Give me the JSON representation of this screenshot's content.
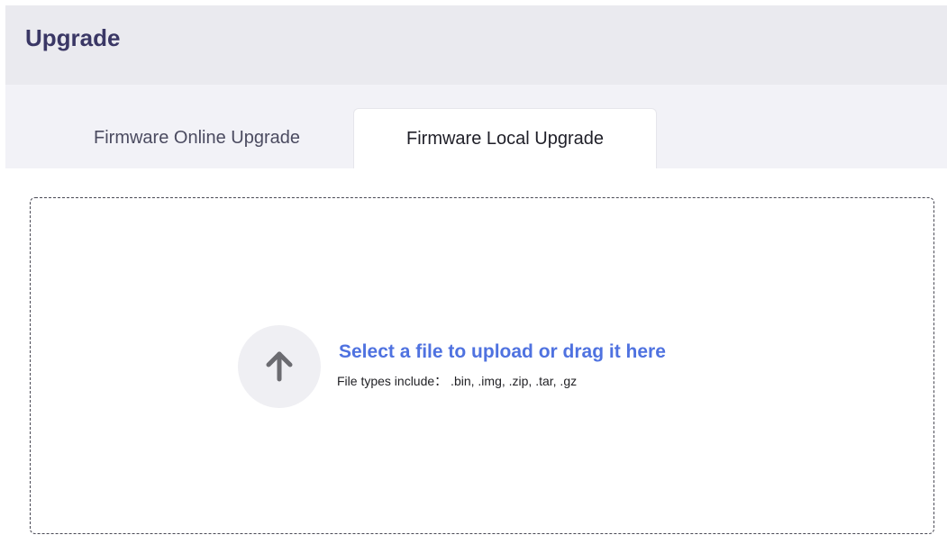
{
  "header": {
    "title": "Upgrade"
  },
  "tabs": [
    {
      "label": "Firmware Online Upgrade",
      "active": false
    },
    {
      "label": "Firmware Local Upgrade",
      "active": true
    }
  ],
  "upload": {
    "icon": "arrow-up-icon",
    "title": "Select a file to upload or drag it here",
    "hint": "File types include： .bin, .img, .zip, .tar, .gz"
  },
  "colors": {
    "header_bg": "#eaeaef",
    "title": "#3a3765",
    "tabbar_bg": "#f2f2f7",
    "link_blue": "#4f72e0",
    "icon_circle": "#efeff3",
    "icon_arrow": "#6b6b70"
  }
}
